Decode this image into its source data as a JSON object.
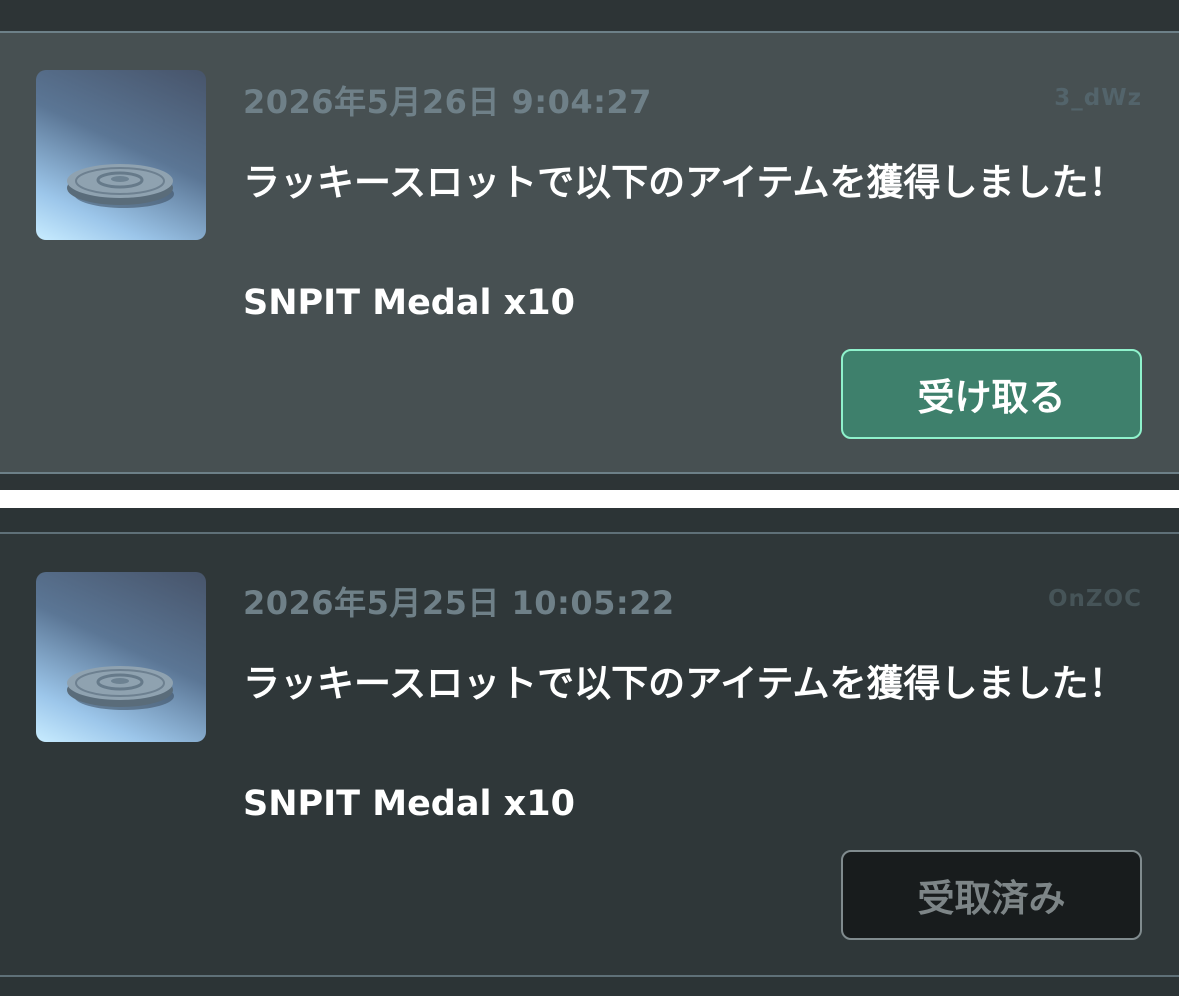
{
  "notifications": [
    {
      "timestamp": "2026年5月26日 9:04:27",
      "user_id": "3_dWz",
      "message": "ラッキースロットで以下のアイテムを獲得しました！",
      "item": "SNPIT Medal x10",
      "item_icon": "medal-coin-icon",
      "button_label": "受け取る",
      "button_state": "claimable"
    },
    {
      "timestamp": "2026年5月25日 10:05:22",
      "user_id": "OnZOC",
      "message": "ラッキースロットで以下のアイテムを獲得しました！",
      "item": "SNPIT Medal x10",
      "item_icon": "medal-coin-icon",
      "button_label": "受取済み",
      "button_state": "claimed"
    }
  ],
  "colors": {
    "claim_button": "#3e806c",
    "claim_button_border": "#8ff2cc",
    "claimed_button": "#181c1d",
    "timestamp_text": "#6f8088"
  }
}
